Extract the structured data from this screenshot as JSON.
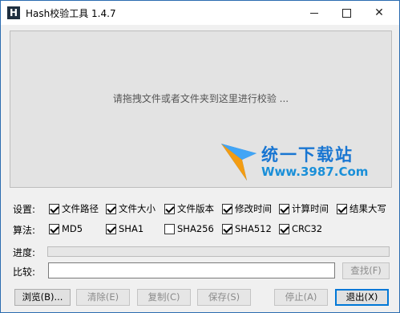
{
  "window": {
    "title": "Hash校验工具 1.4.7",
    "app_icon_letter": "H"
  },
  "drop_area": {
    "hint": "请拖拽文件或者文件夹到这里进行校验 ..."
  },
  "watermark": {
    "title": "统一下载站",
    "url": "Www.3987.Com"
  },
  "settings": {
    "label": "设置:",
    "options": [
      {
        "label": "文件路径",
        "checked": true
      },
      {
        "label": "文件大小",
        "checked": true
      },
      {
        "label": "文件版本",
        "checked": true
      },
      {
        "label": "修改时间",
        "checked": true
      },
      {
        "label": "计算时间",
        "checked": true
      },
      {
        "label": "结果大写",
        "checked": true
      }
    ]
  },
  "algorithms": {
    "label": "算法:",
    "options": [
      {
        "label": "MD5",
        "checked": true
      },
      {
        "label": "SHA1",
        "checked": true
      },
      {
        "label": "SHA256",
        "checked": false
      },
      {
        "label": "SHA512",
        "checked": true
      },
      {
        "label": "CRC32",
        "checked": true
      }
    ]
  },
  "progress": {
    "label": "进度:",
    "value": 0
  },
  "compare": {
    "label": "比较:",
    "value": "",
    "find_button": "查找(F)"
  },
  "buttons": {
    "browse": "浏览(B)...",
    "clear": "清除(E)",
    "copy": "复制(C)",
    "save": "保存(S)",
    "stop": "停止(A)",
    "exit": "退出(X)"
  },
  "colors": {
    "accent": "#0078d7",
    "watermark_blue": "#1976d2",
    "watermark_orange": "#f39c12"
  }
}
